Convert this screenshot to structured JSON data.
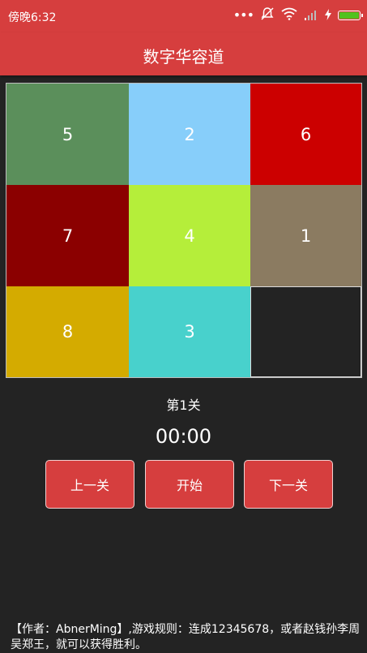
{
  "status_bar": {
    "time": "傍晚6:32",
    "icons": [
      "more-dots-icon",
      "mute-icon",
      "wifi-icon",
      "signal-icon",
      "charging-icon",
      "battery-icon"
    ]
  },
  "app_bar": {
    "title": "数字华容道"
  },
  "board": {
    "rows": 3,
    "cols": 3,
    "tiles": [
      {
        "label": "5",
        "color": "#5b8f5b"
      },
      {
        "label": "2",
        "color": "#87cefa"
      },
      {
        "label": "6",
        "color": "#cc0000"
      },
      {
        "label": "7",
        "color": "#8b0000"
      },
      {
        "label": "4",
        "color": "#b5ee3a"
      },
      {
        "label": "1",
        "color": "#8b7b61"
      },
      {
        "label": "8",
        "color": "#d4ab00"
      },
      {
        "label": "3",
        "color": "#48d1cc"
      },
      {
        "label": "",
        "color": "#232323",
        "empty": true
      }
    ]
  },
  "level_label": "第1关",
  "timer": "00:00",
  "buttons": {
    "prev": "上一关",
    "start": "开始",
    "next": "下一关"
  },
  "footer_text": "【作者：AbnerMing】,游戏规则：连成12345678，或者赵钱孙李周吴郑王，就可以获得胜利。",
  "theme": {
    "primary": "#d63e3e",
    "background": "#232323"
  }
}
